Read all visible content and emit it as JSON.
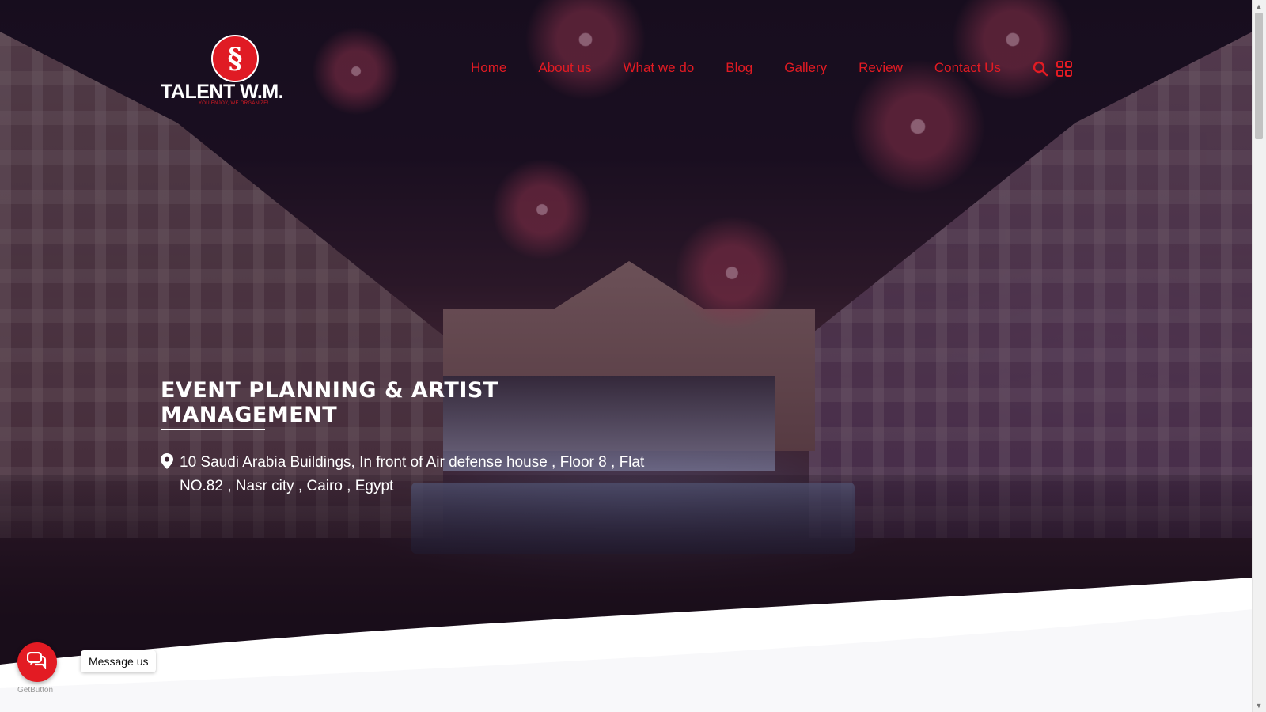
{
  "brand": {
    "logo_text": "TALENT W.M.",
    "tagline": "YOU ENJOY, WE ORGANIZE!",
    "accent_color": "#e31b23"
  },
  "nav": {
    "items": [
      {
        "label": "Home"
      },
      {
        "label": "About us"
      },
      {
        "label": "What we do"
      },
      {
        "label": "Blog"
      },
      {
        "label": "Gallery"
      },
      {
        "label": "Review"
      },
      {
        "label": "Contact Us"
      }
    ],
    "icons": [
      "search-icon",
      "grid-menu-icon"
    ]
  },
  "hero": {
    "headline": "EVENT PLANNING & ARTIST MANAGEMENT",
    "address_icon": "map-pin-icon",
    "address": "10 Saudi Arabia Buildings, In front of Air defense house , Floor 8 , Flat NO.82 , Nasr city , Cairo , Egypt"
  },
  "chat_widget": {
    "icon": "chat-bubble-icon",
    "label": "Message us",
    "provider": "GetButton"
  }
}
